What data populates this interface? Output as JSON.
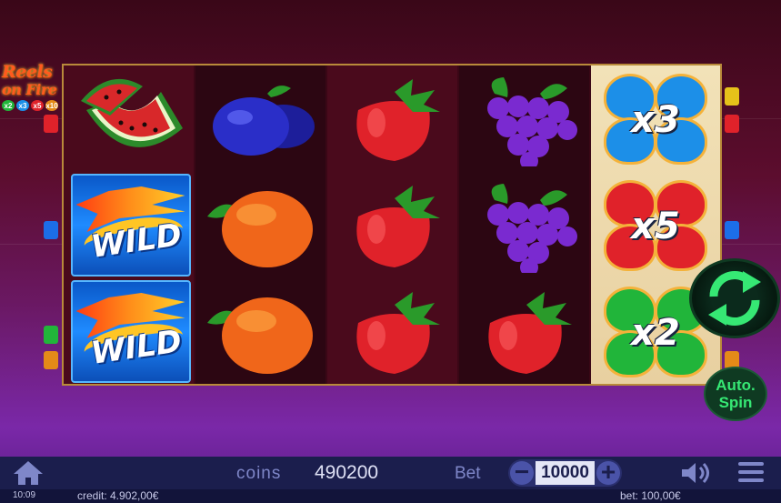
{
  "logo": {
    "title_line1": "Reels",
    "title_line2": "on Fire",
    "multipliers": [
      "x2",
      "x3",
      "x5",
      "x10"
    ]
  },
  "reels": {
    "columns": [
      [
        "watermelon",
        "wild",
        "wild"
      ],
      [
        "plum",
        "orange",
        "orange"
      ],
      [
        "strawberry",
        "strawberry",
        "strawberry"
      ],
      [
        "grapes",
        "grapes",
        "strawberry"
      ]
    ],
    "wild_label": "WILD",
    "bonus_multipliers": [
      {
        "label": "x3",
        "color": "#1c8fe8"
      },
      {
        "label": "x5",
        "color": "#e0222a"
      },
      {
        "label": "x2",
        "color": "#21b53a"
      }
    ]
  },
  "controls": {
    "spin_icon": "refresh-icon",
    "auto_spin_label": "Auto.\nSpin",
    "coins_label": "coins",
    "coins_value": "490200",
    "bet_label": "Bet",
    "bet_value": "10000",
    "bet_minus": "−",
    "bet_plus": "+"
  },
  "status": {
    "time": "10:09",
    "credit": "credit: 4.902,00€",
    "bet": "bet: 100,00€"
  },
  "colors": {
    "accent_green": "#36e874",
    "bar": "#1b1e4d",
    "frame": "#b98a3a"
  }
}
